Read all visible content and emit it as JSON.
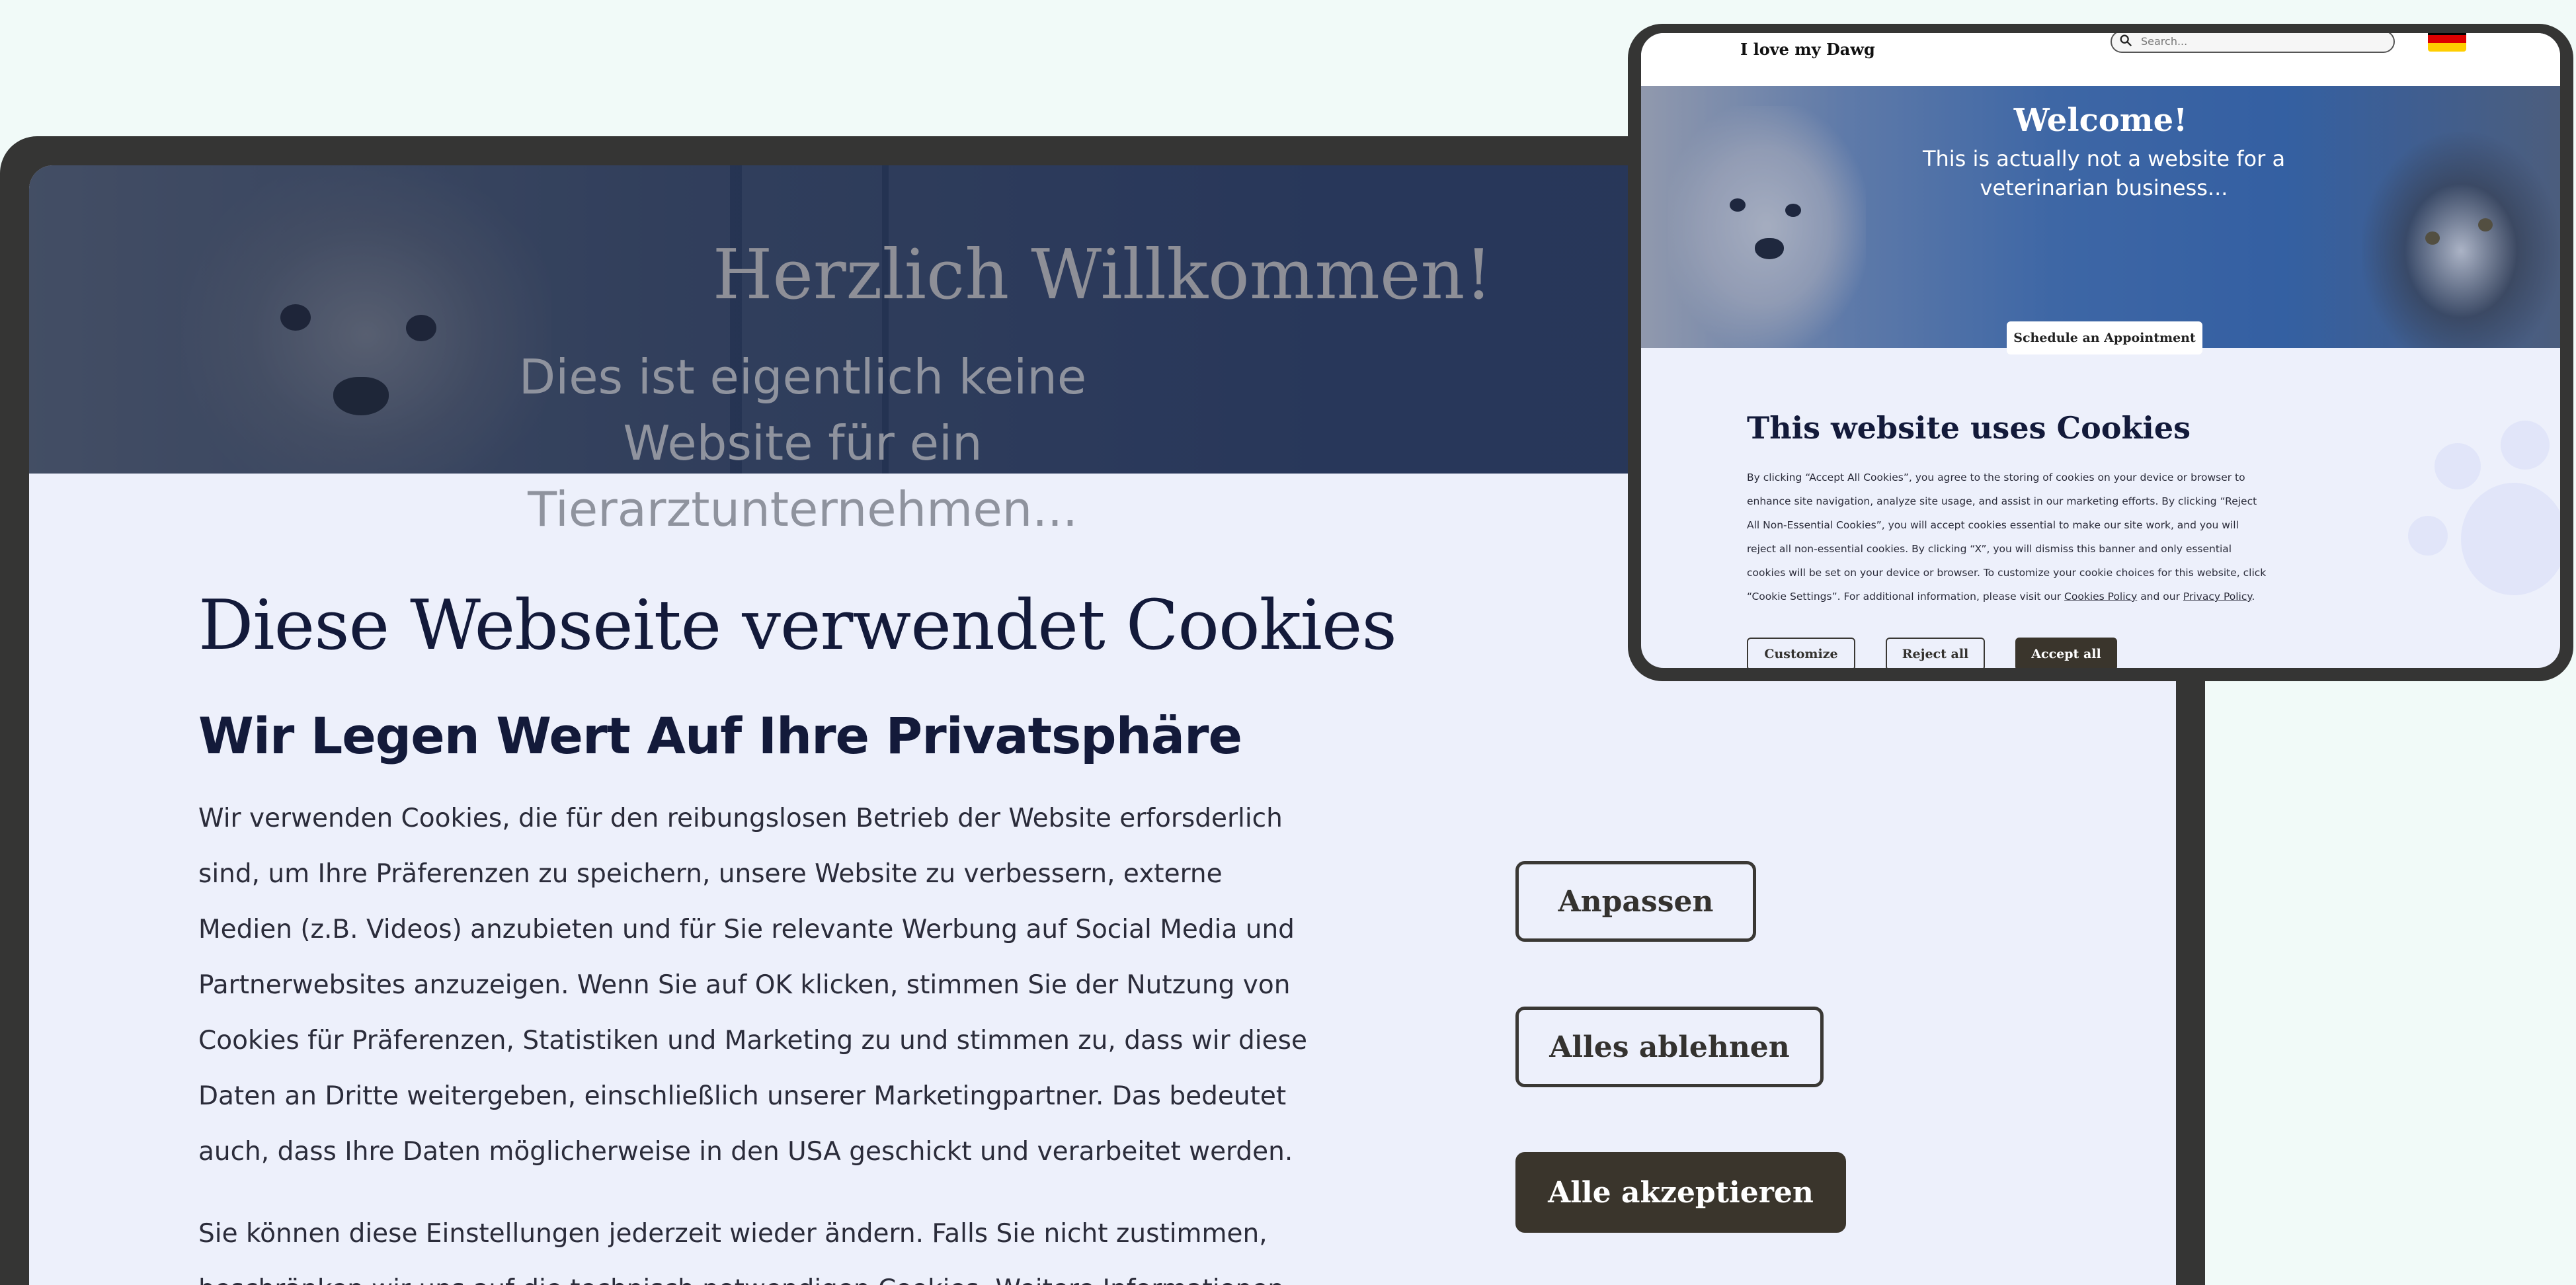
{
  "large_device": {
    "hero": {
      "title": "Herzlich Willkommen!",
      "subtitle": "Dies ist eigentlich keine Website für ein Tierarztunternehmen..."
    },
    "cookie_banner": {
      "title": "Diese Webseite verwendet Cookies",
      "subtitle": "Wir Legen Wert Auf Ihre Privatsphäre",
      "paragraph1": "Wir verwenden Cookies, die für den reibungslosen Betrieb der Website erforsderlich sind, um Ihre Präferenzen zu speichern, unsere Website zu verbessern, externe Medien (z.B. Videos) anzubieten und für Sie relevante Werbung auf Social Media und Partnerwebsites anzuzeigen. Wenn Sie auf OK klicken, stimmen Sie der Nutzung von Cookies für Präferenzen, Statistiken und Marketing zu und stimmen zu, dass wir diese Daten an Dritte weitergeben, einschließlich unserer Marketingpartner. Das bedeutet auch, dass Ihre Daten möglicherweise in den USA geschickt und verarbeitet werden.",
      "paragraph2": "Sie können diese Einstellungen jederzeit wieder ändern. Falls Sie nicht zustimmen, beschränken wir uns auf die technisch notwendigen Cookies. Weitere Informationen und alle",
      "buttons": {
        "customize": "Anpassen",
        "reject": "Alles ablehnen",
        "accept": "Alle akzeptieren"
      }
    }
  },
  "small_device": {
    "navbar": {
      "brand": "I love my Dawg",
      "search_placeholder": "Search...",
      "flag_colors": [
        "#000000",
        "#dd0000",
        "#ffce00"
      ]
    },
    "hero": {
      "title": "Welcome!",
      "subtitle": "This is actually not a website for a veterinarian business...",
      "cta": "Schedule an Appointment"
    },
    "cookie_banner": {
      "title": "This website uses Cookies",
      "body_before_links": "By clicking “Accept All Cookies”, you agree to the storing of cookies on your device or browser to enhance site navigation, analyze site usage, and assist in our marketing efforts. By clicking “Reject All Non-Essential Cookies”, you will accept cookies essential to make our site work, and you will reject all non-essential cookies. By clicking “X”, you will dismiss this banner and only essential cookies will be set on your device or browser. To customize your cookie choices for this website, click “Cookie Settings”. For additional information, please visit our",
      "link_cookies": "Cookies Policy",
      "between_links": "and our",
      "link_privacy": "Privacy Policy",
      "end": ".",
      "buttons": {
        "customize": "Customize",
        "reject": "Reject all",
        "accept": "Accept all"
      }
    }
  },
  "colors": {
    "page_bg": "#f1faf8",
    "device_frame": "#353534",
    "screen_bg": "#edf0fb",
    "heading": "#131a3a",
    "primary_button": "#3a352c"
  }
}
